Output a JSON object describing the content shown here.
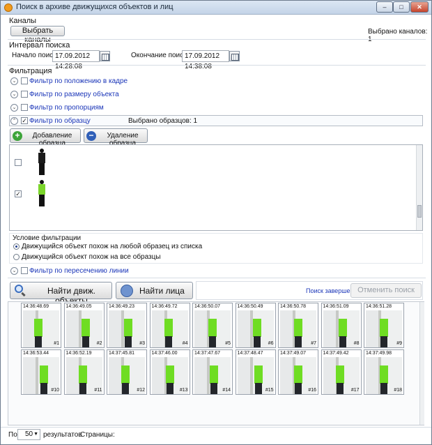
{
  "title": "Поиск в архиве движущихся объектов и лиц",
  "window_buttons": {
    "minimize": "–",
    "maximize": "□",
    "close": "✕"
  },
  "channels": {
    "section": "Каналы",
    "select_button": "Выбрать каналы",
    "selected_text": "Выбрано каналов: 1"
  },
  "interval": {
    "section": "Интервал поиска",
    "start_label": "Начало поиска",
    "start_value": "17.09.2012 14:28:08",
    "end_label": "Окончание поиска",
    "end_value": "17.09.2012 14:38:08"
  },
  "filtration": {
    "section": "Фильтрация",
    "filters": [
      {
        "label": "Фильтр по положению в кадре",
        "checked": false,
        "expanded": false
      },
      {
        "label": "Фильтр по размеру объекта",
        "checked": false,
        "expanded": false
      },
      {
        "label": "Фильтр по пропорциям",
        "checked": false,
        "expanded": false
      },
      {
        "label": "Фильтр по образцу",
        "checked": true,
        "expanded": true
      }
    ],
    "samples_selected": "Выбрано образцов: 1",
    "add_sample": "Добавление образца",
    "remove_sample": "Удаление образца",
    "samples": [
      {
        "checked": false,
        "shirt_color": "#1b1b1b"
      },
      {
        "checked": true,
        "shirt_color": "#7bd52b"
      }
    ],
    "condition_title": "Условие фильтрации",
    "condition_any": "Движущийся объект похож на любой образец из списка",
    "condition_all": "Движущийся объект похож на все образцы",
    "line_filter": "Фильтр по пересечению линии"
  },
  "actions": {
    "find_objects": "Найти движ. объекты",
    "find_faces": "Найти лица",
    "status": "Поиск завершен",
    "cancel": "Отменить поиск"
  },
  "results": [
    {
      "time": "14:36:48.69",
      "num": "#1"
    },
    {
      "time": "14:36:49.05",
      "num": "#2"
    },
    {
      "time": "14:36:49.23",
      "num": "#3"
    },
    {
      "time": "14:36:49.72",
      "num": "#4"
    },
    {
      "time": "14:36:50.07",
      "num": "#5"
    },
    {
      "time": "14:36:50.49",
      "num": "#6"
    },
    {
      "time": "14:36:50.78",
      "num": "#7"
    },
    {
      "time": "14:36:51.09",
      "num": "#8"
    },
    {
      "time": "14:36:51.28",
      "num": "#9"
    },
    {
      "time": "14:36:53.44",
      "num": "#10"
    },
    {
      "time": "14:36:52.19",
      "num": "#11"
    },
    {
      "time": "14:37:45.81",
      "num": "#12"
    },
    {
      "time": "14:37:46.00",
      "num": "#13"
    },
    {
      "time": "14:37:47.67",
      "num": "#14"
    },
    {
      "time": "14:37:48.47",
      "num": "#15"
    },
    {
      "time": "14:37:49.07",
      "num": "#16"
    },
    {
      "time": "14:37:49.42",
      "num": "#17"
    },
    {
      "time": "14:37:49.98",
      "num": "#18"
    }
  ],
  "footer": {
    "per_label": "По",
    "per_value": "50",
    "results_label": "результатов",
    "pages_label": "Страницы:"
  },
  "colors": {
    "shirt_green": "#6fdd23",
    "link_blue": "#1a35b8"
  }
}
